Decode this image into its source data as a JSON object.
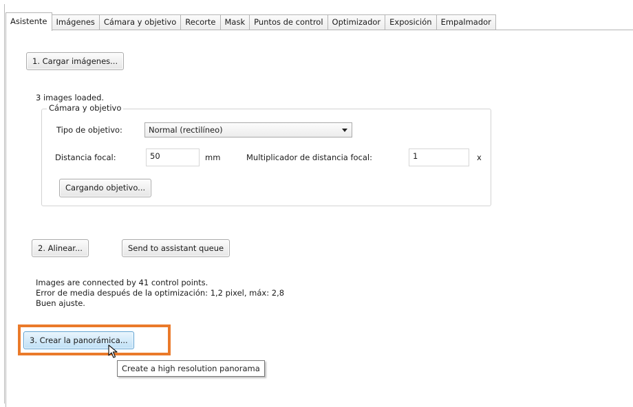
{
  "tabs": [
    {
      "label": "Asistente",
      "active": true
    },
    {
      "label": "Imágenes",
      "active": false
    },
    {
      "label": "Cámara y objetivo",
      "active": false
    },
    {
      "label": "Recorte",
      "active": false
    },
    {
      "label": "Mask",
      "active": false
    },
    {
      "label": "Puntos de control",
      "active": false
    },
    {
      "label": "Optimizador",
      "active": false
    },
    {
      "label": "Exposición",
      "active": false
    },
    {
      "label": "Empalmador",
      "active": false
    }
  ],
  "assistant": {
    "load_button": "1. Cargar imágenes...",
    "images_status": "3 images loaded.",
    "camera_group": {
      "title": "Cámara y objetivo",
      "lens_type_label": "Tipo de objetivo:",
      "lens_type_value": "Normal (rectilíneo)",
      "focal_length_label": "Distancia focal:",
      "focal_length_value": "50",
      "focal_length_unit": "mm",
      "multiplier_label": "Multiplicador de distancia focal:",
      "multiplier_value": "1",
      "multiplier_unit": "x",
      "load_lens_button": "Cargando objetivo..."
    },
    "align_button": "2. Alinear...",
    "queue_button": "Send to assistant queue",
    "result_lines": [
      "Images are connected by 41 control points.",
      "Error de media después de la optimización: 1,2 pixel, máx: 2,8",
      "Buen ajuste."
    ],
    "create_button": "3. Crear la panorámica...",
    "tooltip": "Create a high resolution panorama"
  },
  "colors": {
    "highlight": "#ea7a2a",
    "hover_button": "#bfe0f6"
  },
  "icons": {
    "cursor": "mouse-pointer-icon",
    "dropdown": "chevron-down-icon"
  }
}
